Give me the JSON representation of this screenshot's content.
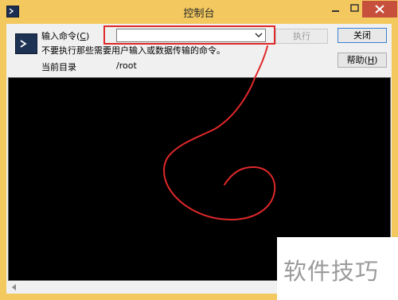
{
  "window": {
    "title": "控制台",
    "icons": {
      "app": "console-app-icon",
      "minimize": "minimize-icon",
      "maximize": "maximize-icon",
      "close": "close-icon"
    },
    "colors": {
      "frame": "#f3c95f",
      "close_button": "#c7503d",
      "annotation": "#e0282a"
    }
  },
  "command": {
    "label": "输入命令(",
    "hotkey": "C",
    "label_suffix": ")",
    "input_value": "",
    "execute_button": "执行",
    "close_button": "关闭",
    "help_button": "帮助(",
    "help_hotkey": "H",
    "help_suffix": ")"
  },
  "warning": "不要执行那些需要用户输入或数据传输的命令。",
  "directory": {
    "label": "当前目录",
    "value": "/root"
  },
  "console_output": "",
  "watermark": "软件技巧"
}
